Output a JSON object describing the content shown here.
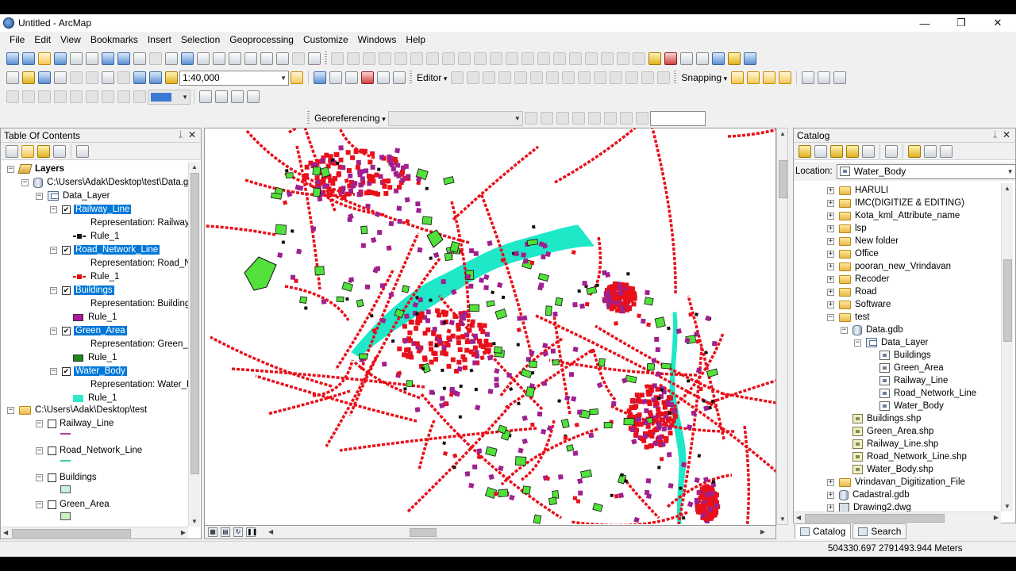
{
  "window": {
    "title": "Untitled - ArcMap",
    "minimize": "—",
    "restore": "❐",
    "close": "✕"
  },
  "menu": [
    "File",
    "Edit",
    "View",
    "Bookmarks",
    "Insert",
    "Selection",
    "Geoprocessing",
    "Customize",
    "Windows",
    "Help"
  ],
  "toolbar": {
    "scale": "1:40,000",
    "editor_label": "Editor",
    "snapping_label": "Snapping",
    "georeferencing_label": "Georeferencing"
  },
  "toc": {
    "title": "Table Of Contents",
    "root": "Layers",
    "gdb_path": "C:\\Users\\Adak\\Desktop\\test\\Data.g",
    "dataset": "Data_Layer",
    "layers": [
      {
        "name": "Railway_Line",
        "representation": "Representation: Railway_",
        "rule": "Rule_1",
        "color": "#111111"
      },
      {
        "name": "Road_Network_Line",
        "representation": "Representation: Road_Ne",
        "rule": "Rule_1",
        "color": "#e01010"
      },
      {
        "name": "Buildings",
        "representation": "Representation: Building",
        "rule": "Rule_1",
        "color": "#b0179a"
      },
      {
        "name": "Green_Area",
        "representation": "Representation: Green_A",
        "rule": "Rule_1",
        "color": "#1a8a1a"
      },
      {
        "name": "Water_Body",
        "representation": "Representation: Water_B",
        "rule": "Rule_1",
        "color": "#2ee8c8"
      }
    ],
    "folder_path": "C:\\Users\\Adak\\Desktop\\test",
    "folder_layers": [
      {
        "name": "Railway_Line",
        "color": "#c03aa0"
      },
      {
        "name": "Road_Network_Line",
        "color": "#40c8b0"
      },
      {
        "name": "Buildings",
        "color": "#c8f0e8"
      },
      {
        "name": "Green_Area",
        "color": "#c8f0c0"
      }
    ]
  },
  "catalog": {
    "title": "Catalog",
    "location_label": "Location:",
    "location_value": "Water_Body",
    "items": [
      {
        "label": "HARULI",
        "type": "folder",
        "indent": 0,
        "exp": "+"
      },
      {
        "label": "IMC(DIGITIZE & EDITING)",
        "type": "folder",
        "indent": 0,
        "exp": "+"
      },
      {
        "label": "Kota_kml_Attribute_name",
        "type": "folder",
        "indent": 0,
        "exp": "+"
      },
      {
        "label": "lsp",
        "type": "folder",
        "indent": 0,
        "exp": "+"
      },
      {
        "label": "New folder",
        "type": "folder",
        "indent": 0,
        "exp": "+"
      },
      {
        "label": "Office",
        "type": "folder",
        "indent": 0,
        "exp": "+"
      },
      {
        "label": "pooran_new_Vrindavan",
        "type": "folder",
        "indent": 0,
        "exp": "+"
      },
      {
        "label": "Recoder",
        "type": "folder",
        "indent": 0,
        "exp": "+"
      },
      {
        "label": "Road",
        "type": "folder",
        "indent": 0,
        "exp": "+"
      },
      {
        "label": "Software",
        "type": "folder",
        "indent": 0,
        "exp": "+"
      },
      {
        "label": "test",
        "type": "folder",
        "indent": 0,
        "exp": "−"
      },
      {
        "label": "Data.gdb",
        "type": "db",
        "indent": 1,
        "exp": "−"
      },
      {
        "label": "Data_Layer",
        "type": "ds",
        "indent": 2,
        "exp": "−"
      },
      {
        "label": "Buildings",
        "type": "fc",
        "indent": 3,
        "exp": ""
      },
      {
        "label": "Green_Area",
        "type": "fc",
        "indent": 3,
        "exp": ""
      },
      {
        "label": "Railway_Line",
        "type": "fc",
        "indent": 3,
        "exp": ""
      },
      {
        "label": "Road_Network_Line",
        "type": "fc",
        "indent": 3,
        "exp": ""
      },
      {
        "label": "Water_Body",
        "type": "fc",
        "indent": 3,
        "exp": ""
      },
      {
        "label": "Buildings.shp",
        "type": "shp",
        "indent": 1,
        "exp": ""
      },
      {
        "label": "Green_Area.shp",
        "type": "shp",
        "indent": 1,
        "exp": ""
      },
      {
        "label": "Railway_Line.shp",
        "type": "shp",
        "indent": 1,
        "exp": ""
      },
      {
        "label": "Road_Network_Line.shp",
        "type": "shp",
        "indent": 1,
        "exp": ""
      },
      {
        "label": "Water_Body.shp",
        "type": "shp",
        "indent": 1,
        "exp": ""
      },
      {
        "label": "Vrindavan_Digitization_File",
        "type": "folder",
        "indent": 0,
        "exp": "+"
      },
      {
        "label": "Cadastral.gdb",
        "type": "db",
        "indent": 0,
        "exp": "+"
      },
      {
        "label": "Drawing2.dwg",
        "type": "dwg",
        "indent": 0,
        "exp": "+"
      }
    ],
    "tabs": [
      "Catalog",
      "Search"
    ]
  },
  "status": {
    "coordinates": "504330.697  2791493.944 Meters"
  },
  "colors": {
    "road": "#e8101a",
    "building": "#a0208f",
    "green": "#52e03a",
    "water": "#1fe8c8",
    "railway": "#111111"
  }
}
